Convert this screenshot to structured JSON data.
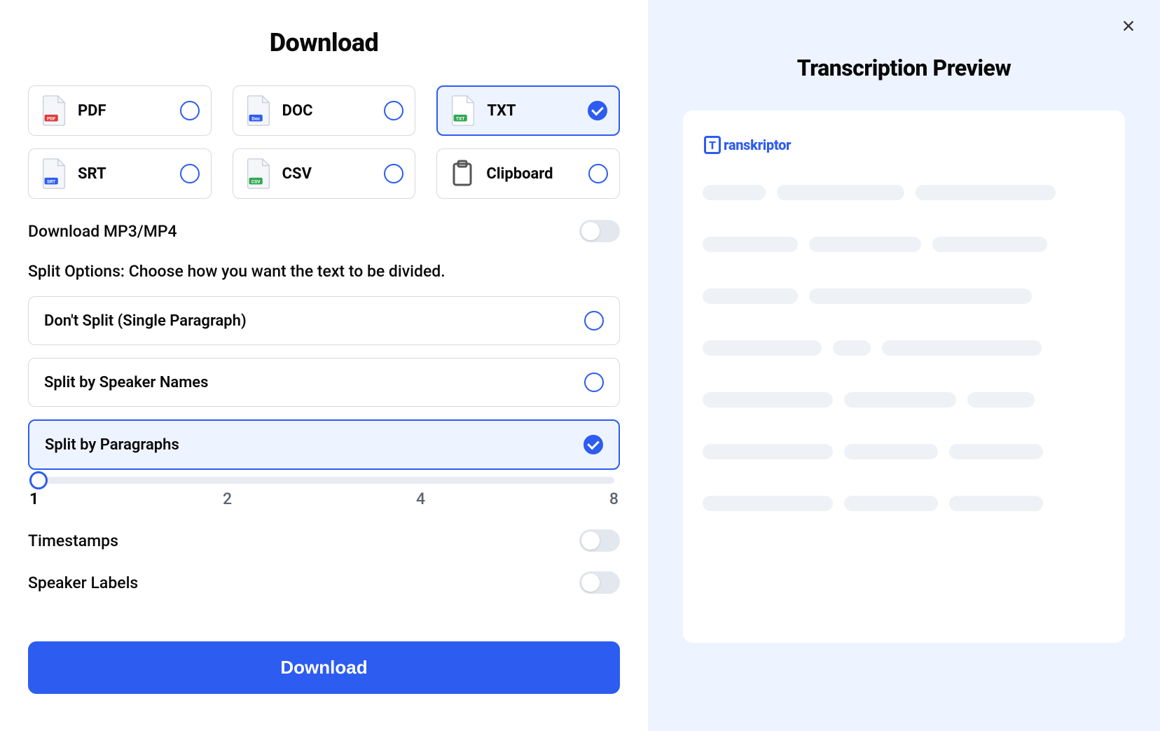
{
  "title": "Download",
  "formats": [
    {
      "label": "PDF",
      "badge": "PDF",
      "badgeColor": "#e03a3a",
      "selected": false
    },
    {
      "label": "DOC",
      "badge": "Doc",
      "badgeColor": "#2d5cf0",
      "selected": false
    },
    {
      "label": "TXT",
      "badge": "TXT",
      "badgeColor": "#2fa84f",
      "selected": true
    },
    {
      "label": "SRT",
      "badge": "SRT",
      "badgeColor": "#2d5cf0",
      "selected": false
    },
    {
      "label": "CSV",
      "badge": "CSV",
      "badgeColor": "#2fa84f",
      "selected": false
    },
    {
      "label": "Clipboard",
      "clipboard": true,
      "selected": false
    }
  ],
  "downloadMedia": {
    "label": "Download MP3/MP4",
    "on": false
  },
  "splitHeading": "Split Options: Choose how you want the text to be divided.",
  "splitOptions": [
    {
      "label": "Don't Split (Single Paragraph)",
      "selected": false
    },
    {
      "label": "Split by Speaker Names",
      "selected": false
    },
    {
      "label": "Split by Paragraphs",
      "selected": true
    }
  ],
  "slider": {
    "value": 1,
    "ticks": [
      "1",
      "2",
      "4",
      "8"
    ]
  },
  "timestamps": {
    "label": "Timestamps",
    "on": false
  },
  "speakerLabels": {
    "label": "Speaker Labels",
    "on": false
  },
  "downloadButton": "Download",
  "preview": {
    "title": "Transcription Preview",
    "brand": "ranskriptor",
    "brandInitial": "T"
  }
}
